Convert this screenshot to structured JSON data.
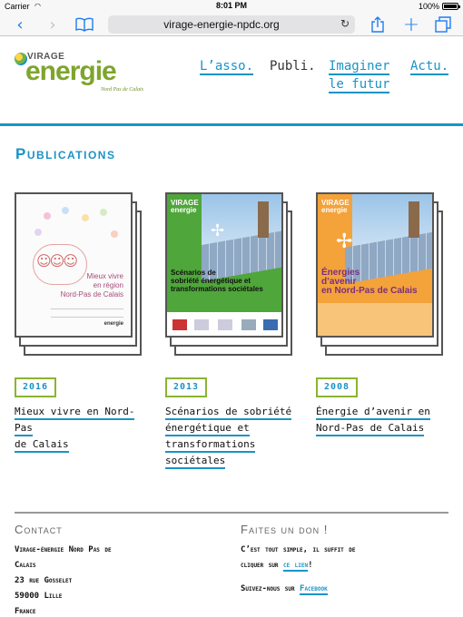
{
  "status_bar": {
    "carrier": "Carrier",
    "time": "8:01 PM",
    "battery": "100%"
  },
  "browser": {
    "url": "virage-energie-npdc.org"
  },
  "logo": {
    "virage": "VIRAGE",
    "energie": "energie",
    "region": "Nord Pas de Calais"
  },
  "nav": {
    "asso": "L’asso.",
    "publi": "Publi.",
    "imaginer_1": "Imaginer",
    "imaginer_2": "le futur",
    "actu": "Actu."
  },
  "section_title": "Publications",
  "publications": [
    {
      "year": "2016",
      "title_lines": [
        "Mieux vivre en Nord-Pas",
        "de Calais"
      ],
      "cover_text": [
        "Mieux vivre",
        "en région",
        "Nord-Pas de Calais"
      ]
    },
    {
      "year": "2013",
      "title_lines": [
        "Scénarios de sobriété",
        "énergétique et",
        "transformations",
        "sociétales"
      ],
      "cover_text": [
        "Scénarios de",
        "sobriété énergétique et",
        "transformations sociétales"
      ]
    },
    {
      "year": "2008",
      "title_lines": [
        "Énergie d’avenir en",
        "Nord-Pas de Calais"
      ],
      "cover_text": [
        "Énergies",
        "d’avenir",
        "en Nord-Pas de Calais"
      ]
    }
  ],
  "footer": {
    "contact_heading": "Contact",
    "contact_lines": [
      "Virage-énergie Nord Pas de",
      "Calais",
      "23 rue Gosselet",
      "59000 Lille",
      "France"
    ],
    "don_heading": "Faites un don !",
    "don_text_1": "C’est tout simple, il suffit de",
    "don_text_2": "cliquer sur",
    "don_link": "ce lien",
    "don_text_3": "!",
    "follow_text": "Suivez-nous sur",
    "follow_link": "Facebook"
  },
  "colors": {
    "accent": "#1a93c6",
    "green": "#8ab531",
    "logo_green": "#7ea52d"
  }
}
